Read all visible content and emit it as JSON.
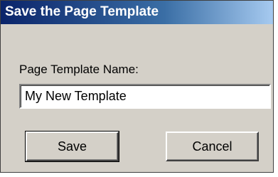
{
  "dialog": {
    "title": "Save the Page Template",
    "field_label": "Page Template Name:",
    "name_value": "My New Template",
    "save_label": "Save",
    "cancel_label": "Cancel"
  },
  "colors": {
    "title_bar_start": "#0a246a",
    "title_bar_end": "#a6caf0",
    "dialog_background": "#d4d0c8"
  }
}
